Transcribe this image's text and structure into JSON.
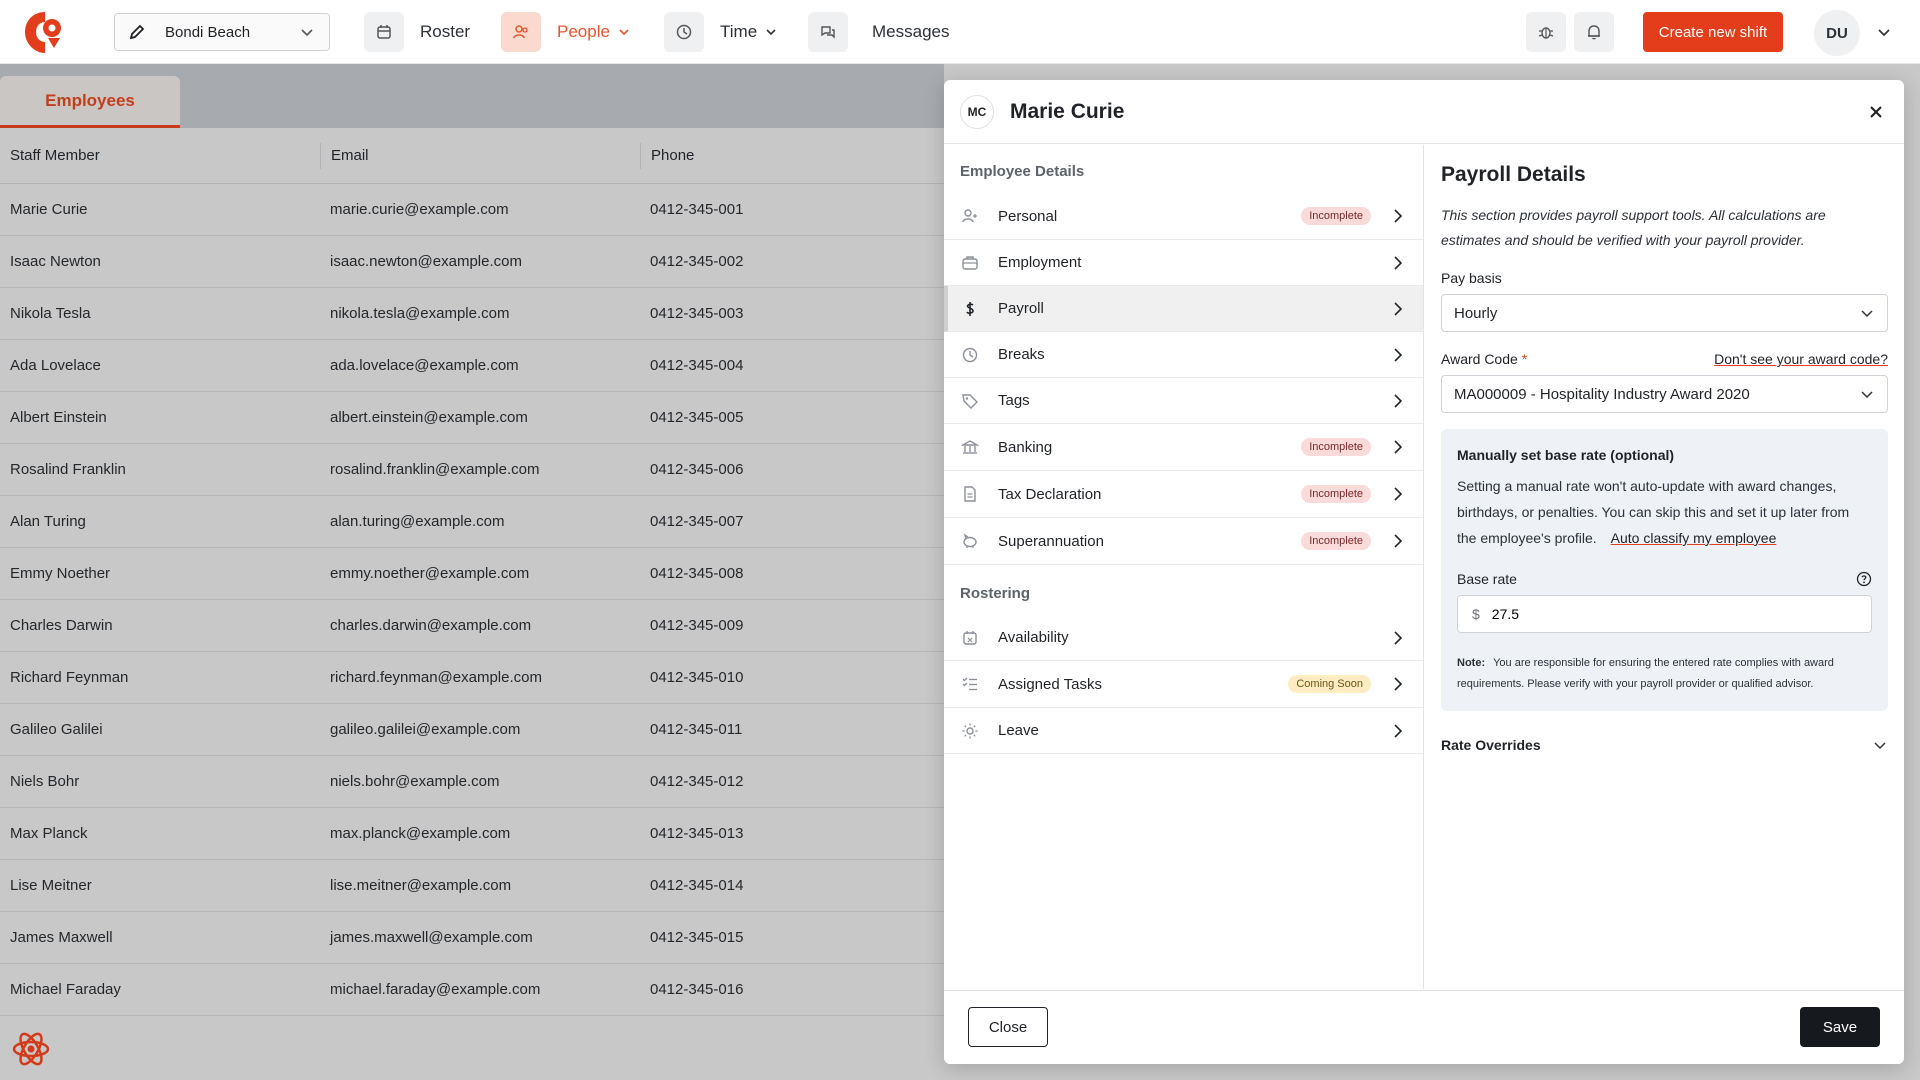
{
  "colors": {
    "brand": "#e23e1c",
    "accent_nav": "#e8542b",
    "badge_incomplete": "#fbdada",
    "badge_soon": "#fcecc1"
  },
  "topbar": {
    "location": "Bondi Beach",
    "nav": [
      {
        "label": "Roster",
        "icon": "calendar-icon"
      },
      {
        "label": "People",
        "icon": "people-icon"
      },
      {
        "label": "Time",
        "icon": "clock-icon"
      },
      {
        "label": "Messages",
        "icon": "chat-icon"
      }
    ],
    "create_label": "Create new shift",
    "avatar": "DU"
  },
  "employees_tab": "Employees",
  "table": {
    "headers": [
      "Staff Member",
      "Email",
      "Phone"
    ],
    "rows": [
      [
        "Marie Curie",
        "marie.curie@example.com",
        "0412-345-001"
      ],
      [
        "Isaac Newton",
        "isaac.newton@example.com",
        "0412-345-002"
      ],
      [
        "Nikola Tesla",
        "nikola.tesla@example.com",
        "0412-345-003"
      ],
      [
        "Ada Lovelace",
        "ada.lovelace@example.com",
        "0412-345-004"
      ],
      [
        "Albert Einstein",
        "albert.einstein@example.com",
        "0412-345-005"
      ],
      [
        "Rosalind Franklin",
        "rosalind.franklin@example.com",
        "0412-345-006"
      ],
      [
        "Alan Turing",
        "alan.turing@example.com",
        "0412-345-007"
      ],
      [
        "Emmy Noether",
        "emmy.noether@example.com",
        "0412-345-008"
      ],
      [
        "Charles Darwin",
        "charles.darwin@example.com",
        "0412-345-009"
      ],
      [
        "Richard Feynman",
        "richard.feynman@example.com",
        "0412-345-010"
      ],
      [
        "Galileo Galilei",
        "galileo.galilei@example.com",
        "0412-345-011"
      ],
      [
        "Niels Bohr",
        "niels.bohr@example.com",
        "0412-345-012"
      ],
      [
        "Max Planck",
        "max.planck@example.com",
        "0412-345-013"
      ],
      [
        "Lise Meitner",
        "lise.meitner@example.com",
        "0412-345-014"
      ],
      [
        "James Maxwell",
        "james.maxwell@example.com",
        "0412-345-015"
      ],
      [
        "Michael Faraday",
        "michael.faraday@example.com",
        "0412-345-016"
      ]
    ]
  },
  "modal": {
    "initials": "MC",
    "name": "Marie Curie",
    "employee_details_title": "Employee Details",
    "employee_items": [
      {
        "label": "Personal",
        "icon": "person-icon",
        "badge": "Incomplete"
      },
      {
        "label": "Employment",
        "icon": "briefcase-icon",
        "badge": ""
      },
      {
        "label": "Payroll",
        "icon": "dollar-icon",
        "badge": ""
      },
      {
        "label": "Breaks",
        "icon": "clock-icon",
        "badge": ""
      },
      {
        "label": "Tags",
        "icon": "tag-icon",
        "badge": ""
      },
      {
        "label": "Banking",
        "icon": "bank-icon",
        "badge": "Incomplete"
      },
      {
        "label": "Tax Declaration",
        "icon": "document-icon",
        "badge": "Incomplete"
      },
      {
        "label": "Superannuation",
        "icon": "piggy-bank-icon",
        "badge": "Incomplete"
      }
    ],
    "rostering_title": "Rostering",
    "rostering_items": [
      {
        "label": "Availability",
        "icon": "calendar-x-icon",
        "badge": ""
      },
      {
        "label": "Assigned Tasks",
        "icon": "checklist-icon",
        "badge": "Coming Soon"
      },
      {
        "label": "Leave",
        "icon": "sun-icon",
        "badge": ""
      }
    ],
    "payroll": {
      "title": "Payroll Details",
      "description": "This section provides payroll support tools. All calculations are estimates and should be verified with your payroll provider.",
      "pay_basis_label": "Pay basis",
      "pay_basis_value": "Hourly",
      "award_code_label": "Award Code",
      "award_link": "Don't see your award code?",
      "award_value": "MA000009 - Hospitality Industry Award 2020",
      "manual_title": "Manually set base rate (optional)",
      "manual_desc": "Setting a manual rate won't auto-update with award changes, birthdays, or penalties. You can skip this and set it up later from the employee's profile.",
      "auto_classify": "Auto classify my employee",
      "base_rate_label": "Base rate",
      "currency": "$",
      "base_rate_value": "27.5",
      "note_label": "Note:",
      "note_text": "You are responsible for ensuring the entered rate complies with award requirements. Please verify with your payroll provider or qualified advisor.",
      "rate_overrides": "Rate Overrides"
    },
    "close_label": "Close",
    "save_label": "Save"
  }
}
